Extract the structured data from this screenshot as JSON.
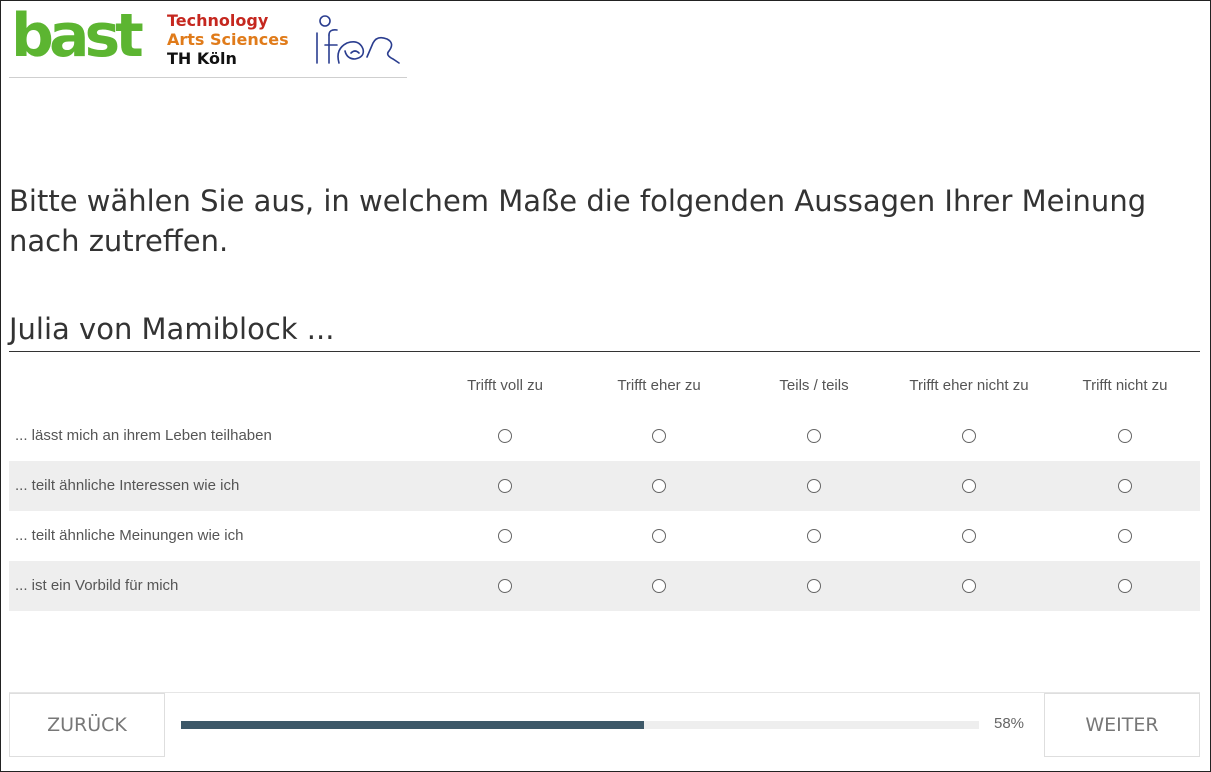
{
  "header": {
    "logo_bast": "bast",
    "logo_thk": {
      "line1": "Technology",
      "line2": "Arts Sciences",
      "line3": "TH Köln"
    },
    "logo_ifes": "ifes"
  },
  "question": {
    "text": "Bitte wählen Sie aus, in welchem Maße die folgenden Aussagen Ihrer Meinung nach zutreffen.",
    "subject": "Julia von Mamiblock ..."
  },
  "matrix": {
    "columns": [
      "Trifft voll zu",
      "Trifft eher zu",
      "Teils / teils",
      "Trifft eher nicht zu",
      "Trifft nicht zu"
    ],
    "rows": [
      {
        "label": "... lässt mich an ihrem Leben teilhaben"
      },
      {
        "label": "... teilt ähnliche Interessen wie ich"
      },
      {
        "label": "... teilt ähnliche Meinungen wie ich"
      },
      {
        "label": "... ist ein Vorbild für mich"
      }
    ]
  },
  "footer": {
    "back_label": "ZURÜCK",
    "next_label": "WEITER",
    "progress_value": 0.58,
    "progress_label": "58%"
  },
  "colors": {
    "bast_green": "#5cb531",
    "thk_red": "#c5271f",
    "thk_orange": "#e07b1a",
    "ifes_blue": "#2a3d8f",
    "progress_fill": "#3d5868",
    "row_alt_bg": "#eeeeee"
  }
}
